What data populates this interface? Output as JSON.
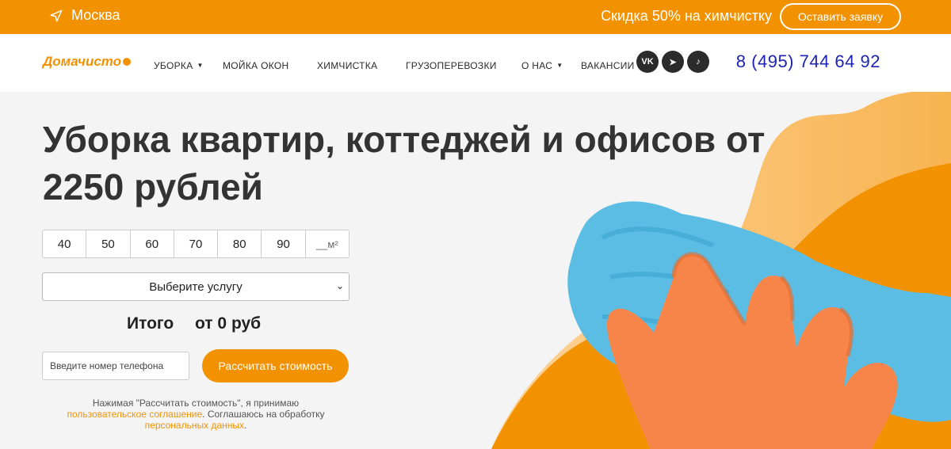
{
  "topbar": {
    "city": "Москва",
    "promo": "Скидка 50% на химчистку",
    "request_button": "Оставить заявку"
  },
  "header": {
    "logo_text": "Домачисто",
    "nav": [
      {
        "label": "УБОРКА",
        "has_dropdown": true
      },
      {
        "label": "МОЙКА ОКОН",
        "has_dropdown": false
      },
      {
        "label": "ХИМЧИСТКА",
        "has_dropdown": false
      },
      {
        "label": "ГРУЗОПЕРЕВОЗКИ",
        "has_dropdown": false
      },
      {
        "label": "О НАС",
        "has_dropdown": true
      },
      {
        "label": "ВАКАНСИИ",
        "has_dropdown": false
      }
    ],
    "social": [
      {
        "icon": "vk-icon",
        "glyph": "VK"
      },
      {
        "icon": "telegram-icon",
        "glyph": "➤"
      },
      {
        "icon": "tiktok-icon",
        "glyph": "♪"
      }
    ],
    "phone": "8 (495) 744 64 92"
  },
  "hero": {
    "title": "Уборка квартир, коттеджей и офисов от 2250 рублей",
    "sizes": [
      "40",
      "50",
      "60",
      "70",
      "80",
      "90",
      "__м²"
    ],
    "service_select": "Выберите услугу",
    "total_label": "Итого",
    "total_value": "от 0 руб",
    "phone_placeholder": "Введите номер телефона",
    "calc_button": "Рассчитать стоимость",
    "consent": {
      "part1": "Нажимая \"Рассчитать стоимость\", я принимаю",
      "link1": "пользовательское соглашение",
      "part2": ". Соглашаюсь на обработку",
      "link2": "персональных данных",
      "part3": "."
    }
  },
  "colors": {
    "accent": "#f39200",
    "phone": "#1e23b5",
    "background": "#f4f4f4"
  }
}
